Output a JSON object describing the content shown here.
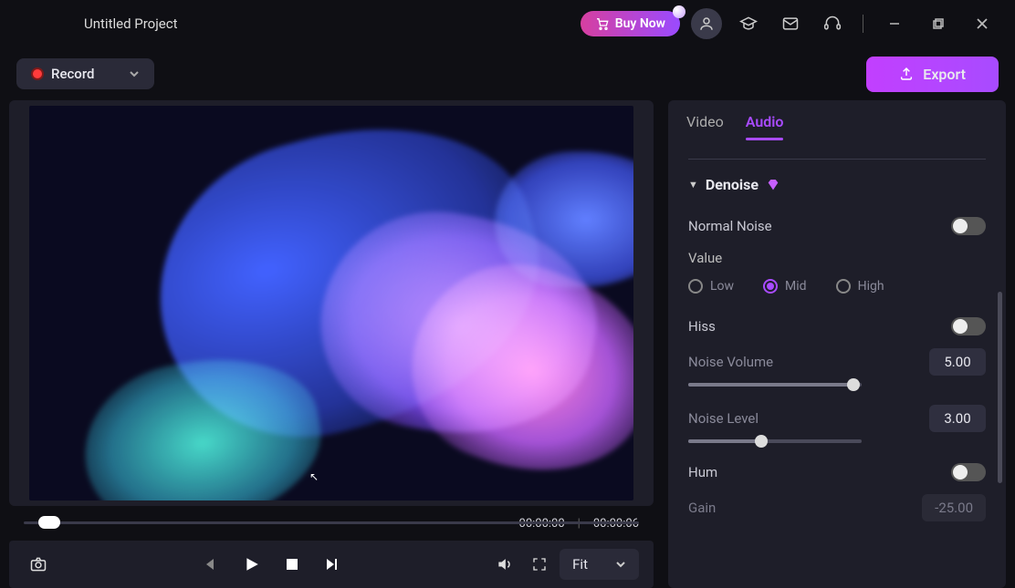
{
  "header": {
    "project_title": "Untitled Project",
    "buy_label": "Buy Now"
  },
  "toolbar": {
    "record_label": "Record",
    "export_label": "Export"
  },
  "playback": {
    "time_current": "00:00:00",
    "time_total": "00:00:06",
    "zoom_mode": "Fit"
  },
  "panel": {
    "tabs": {
      "video": "Video",
      "audio": "Audio"
    },
    "active_tab": "audio",
    "denoise": {
      "title": "Denoise",
      "normal_noise": {
        "label": "Normal Noise",
        "on": false
      },
      "value_label": "Value",
      "value_options": {
        "low": "Low",
        "mid": "Mid",
        "high": "High"
      },
      "value_selected": "mid",
      "hiss": {
        "label": "Hiss",
        "on": false
      },
      "noise_volume": {
        "label": "Noise Volume",
        "value": "5.00",
        "pct": 95
      },
      "noise_level": {
        "label": "Noise Level",
        "value": "3.00",
        "pct": 42
      },
      "hum": {
        "label": "Hum",
        "on": false
      },
      "gain": {
        "label": "Gain",
        "value": "-25.00"
      }
    }
  }
}
